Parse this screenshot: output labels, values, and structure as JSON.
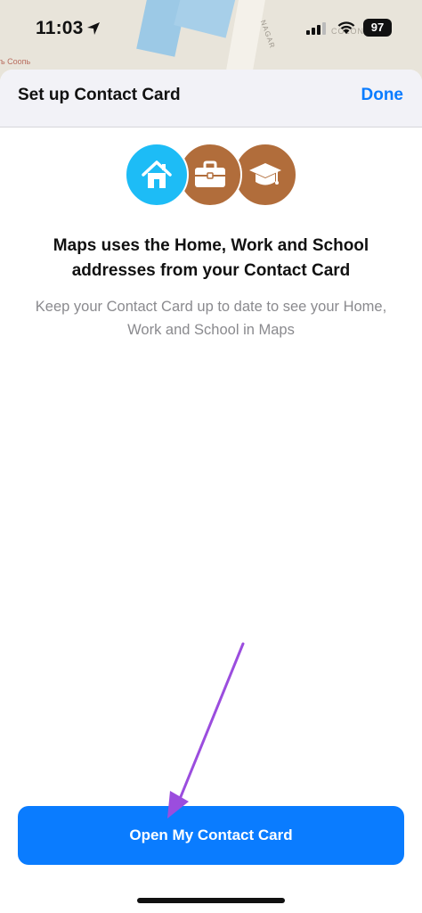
{
  "status_bar": {
    "time": "11:03",
    "battery": "97",
    "location_icon": "location-arrow-icon",
    "signal_icon": "cellular-signal-icon",
    "wifi_icon": "wifi-icon"
  },
  "map": {
    "label_left": "ъ Соопь",
    "label_street": "NAGAR",
    "label_right": "COLONY"
  },
  "sheet": {
    "title": "Set up Contact Card",
    "done_label": "Done",
    "icons": [
      "home-icon",
      "briefcase-icon",
      "graduation-cap-icon"
    ],
    "headline": "Maps uses the Home, Work and School addresses from your Contact Card",
    "subtext": "Keep your Contact Card up to date to see your Home, Work and School in Maps",
    "primary_button": "Open My Contact Card"
  },
  "colors": {
    "accent": "#0a7cff",
    "home_circle": "#1dbcf6",
    "work_school_circle": "#b16d3b",
    "annotation_arrow": "#9b4dde"
  }
}
